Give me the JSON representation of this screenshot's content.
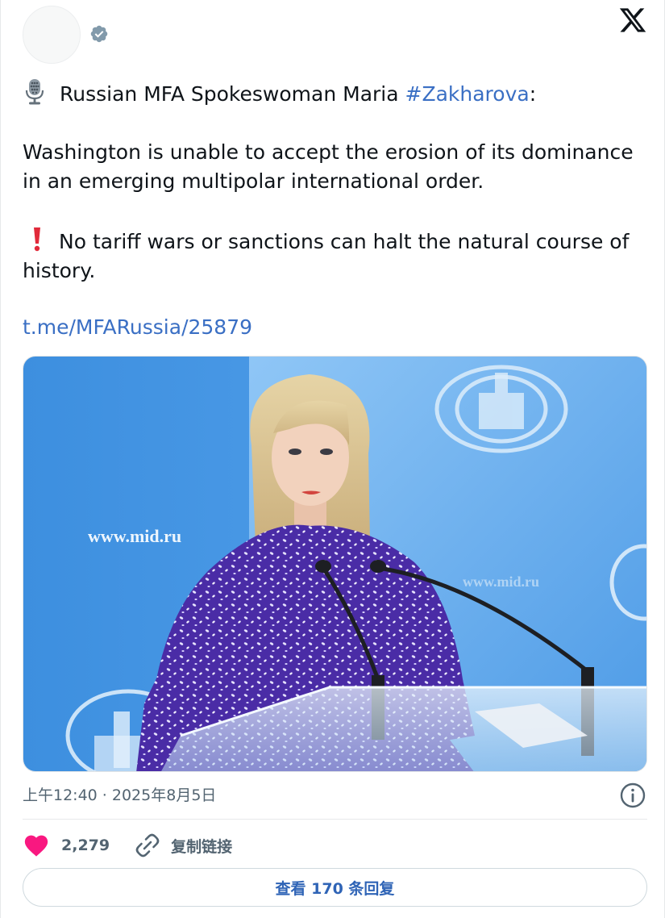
{
  "post": {
    "intro_text": "Russian MFA Spokeswoman Maria ",
    "hashtag": "#Zakharova",
    "intro_suffix": ":",
    "paragraph_2": "Washington is unable to accept the erosion of its dominance in an emerging multipolar international order.",
    "paragraph_3": "No tariff wars or sanctions can halt the natural course of history.",
    "link_text": "t.me/MFARussia/25879",
    "emoji_1": "microphone-icon",
    "emoji_2": "exclamation-icon",
    "backdrop_site_text": "www.mid.ru"
  },
  "meta": {
    "timestamp": "上午12:40 · 2025年8月5日"
  },
  "actions": {
    "like_count": "2,279",
    "copy_link_label": "复制链接"
  },
  "footer": {
    "replies_button_label": "查看 170 条回复"
  },
  "colors": {
    "link": "#3a6fc4",
    "heart": "#f91880",
    "muted": "#536471",
    "verified_badge": "#829aab"
  }
}
